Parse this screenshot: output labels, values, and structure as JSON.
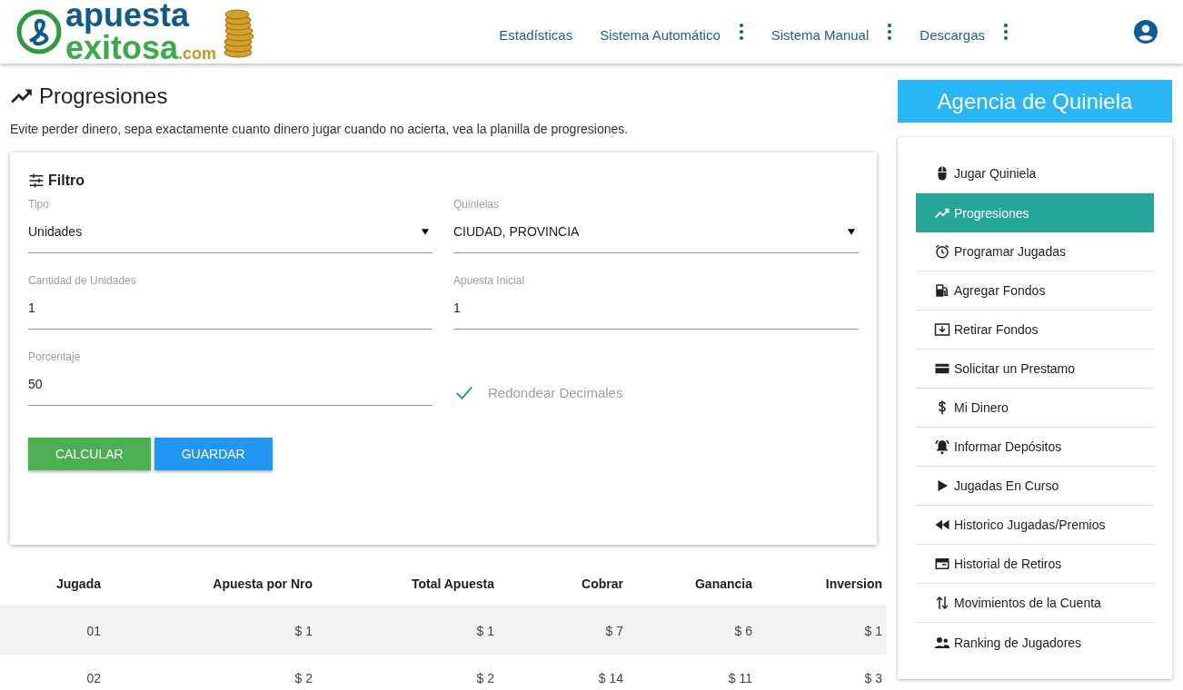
{
  "header": {
    "logo": {
      "line_1": "apuesta",
      "line_2": "exitosa",
      "suffix": ".com"
    },
    "nav": [
      {
        "label": "Estadísticas",
        "menu": false
      },
      {
        "label": "Sistema Automático",
        "menu": true
      },
      {
        "label": "Sistema Manual",
        "menu": true
      },
      {
        "label": "Descargas",
        "menu": true
      }
    ]
  },
  "page": {
    "title": "Progresiones",
    "description": "Evite perder dinero, sepa exactamente cuanto dinero jugar cuando no acierta, vea la planilla de progresiones."
  },
  "filter": {
    "title": "Filtro",
    "fields": [
      {
        "kind": "select",
        "label": "Tipo",
        "value": "Unidades"
      },
      {
        "kind": "select",
        "label": "Quinielas",
        "value": "CIUDAD, PROVINCIA"
      },
      {
        "kind": "input",
        "label": "Cantidad de Unidades",
        "value": "1"
      },
      {
        "kind": "input",
        "label": "Apuesta Inicial",
        "value": "1"
      },
      {
        "kind": "input",
        "label": "Porcentaje",
        "value": "50"
      },
      {
        "kind": "checkbox",
        "label": "Redondear Decimales",
        "checked": true
      }
    ],
    "buttons": [
      {
        "label": "CALCULAR",
        "kind": "primary"
      },
      {
        "label": "GUARDAR",
        "kind": "secondary"
      }
    ]
  },
  "table": {
    "columns": [
      "Jugada",
      "Apuesta por Nro",
      "Total Apuesta",
      "Cobrar",
      "Ganancia",
      "Inversion"
    ],
    "rows": [
      [
        "01",
        "$ 1",
        "$ 1",
        "$ 7",
        "$ 6",
        "$ 1"
      ],
      [
        "02",
        "$ 2",
        "$ 2",
        "$ 14",
        "$ 11",
        "$ 3"
      ]
    ]
  },
  "sidebar": {
    "title": "Agencia de Quiniela",
    "items": [
      {
        "label": "Jugar Quiniela",
        "selected": false
      },
      {
        "label": "Progresiones",
        "selected": true
      },
      {
        "label": "Programar Jugadas",
        "selected": false
      },
      {
        "label": "Agregar Fondos",
        "selected": false
      },
      {
        "label": "Retirar Fondos",
        "selected": false
      },
      {
        "label": "Solicitar un Prestamo",
        "selected": false
      },
      {
        "label": "Mi Dinero",
        "selected": false
      },
      {
        "label": "Informar Depósitos",
        "selected": false
      },
      {
        "label": "Jugadas En Curso",
        "selected": false
      },
      {
        "label": "Historico Jugadas/Premios",
        "selected": false
      },
      {
        "label": "Historial de Retiros",
        "selected": false
      },
      {
        "label": "Movimientos de la Cuenta",
        "selected": false
      },
      {
        "label": "Ranking de Jugadores",
        "selected": false
      }
    ]
  }
}
